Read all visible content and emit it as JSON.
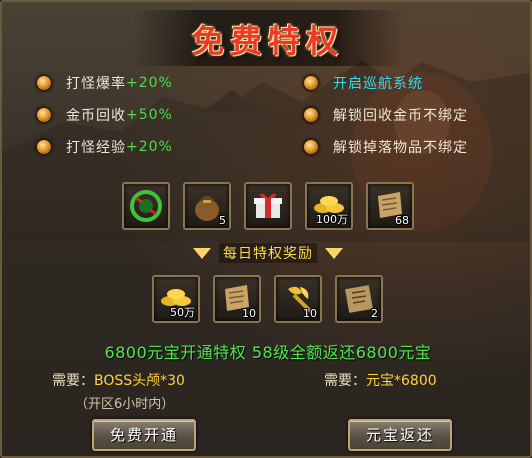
{
  "title": "免费特权",
  "perks_left": [
    {
      "label": "打怪爆率",
      "value": "+20%"
    },
    {
      "label": "金币回收",
      "value": "+50%"
    },
    {
      "label": "打怪经验",
      "value": "+20%"
    }
  ],
  "perks_right": [
    {
      "label": "开启巡航系统"
    },
    {
      "label": "解锁回收金币不绑定"
    },
    {
      "label": "解锁掉落物品不绑定"
    }
  ],
  "reward_items": [
    {
      "icon": "green-orb-icon",
      "qty": ""
    },
    {
      "icon": "pouch-icon",
      "qty": "5"
    },
    {
      "icon": "gift-box-icon",
      "qty": ""
    },
    {
      "icon": "gold-ingots-icon",
      "qty": "100万"
    },
    {
      "icon": "scroll-icon",
      "qty": "68"
    }
  ],
  "daily_header": "每日特权奖励",
  "daily_items": [
    {
      "icon": "gold-ingots-icon",
      "qty": "50万"
    },
    {
      "icon": "scroll-icon",
      "qty": "10"
    },
    {
      "icon": "golden-axe-icon",
      "qty": "10"
    },
    {
      "icon": "book-icon",
      "qty": "2"
    }
  ],
  "summary": "6800元宝开通特权  58级全额返还6800元宝",
  "requirements": {
    "left_label": "需要：",
    "left_value": "BOSS头颅*30",
    "right_label": "需要：",
    "right_value": "元宝*6800",
    "note": "（开区6小时内）"
  },
  "buttons": {
    "free_open": "免费开通",
    "refund": "元宝返还"
  },
  "colors": {
    "title": "#e8392a",
    "value_green": "#46e046",
    "feature_cyan": "#39d9f0",
    "requirement_gold": "#ffd23a"
  }
}
